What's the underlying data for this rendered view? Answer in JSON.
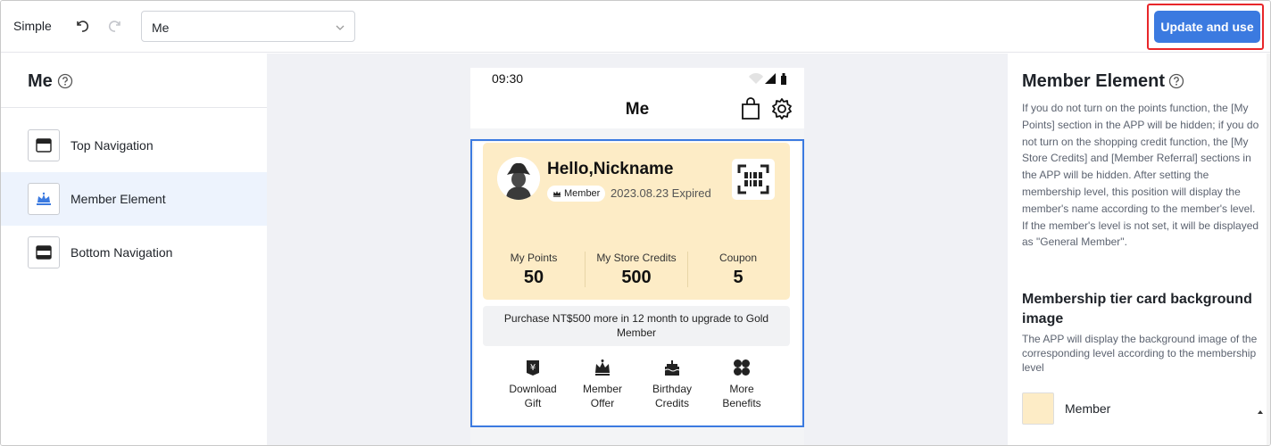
{
  "topbar": {
    "mode_label": "Simple",
    "page_select_value": "Me",
    "update_button_label": "Update and use"
  },
  "left_panel": {
    "title": "Me",
    "items": [
      {
        "label": "Top Navigation",
        "icon": "top-navigation-icon",
        "active": false
      },
      {
        "label": "Member Element",
        "icon": "crown-icon",
        "active": true
      },
      {
        "label": "Bottom Navigation",
        "icon": "bottom-navigation-icon",
        "active": false
      }
    ]
  },
  "phone": {
    "time": "09:30",
    "title": "Me",
    "member": {
      "greeting": "Hello,Nickname",
      "badge": "Member",
      "expires": "2023.08.23 Expired",
      "stats": [
        {
          "label": "My Points",
          "value": "50"
        },
        {
          "label": "My Store Credits",
          "value": "500"
        },
        {
          "label": "Coupon",
          "value": "5"
        }
      ],
      "upgrade_text": "Purchase NT$500 more in 12 month to upgrade to Gold Member",
      "benefits": [
        {
          "line1": "Download",
          "line2": "Gift",
          "icon": "gift-icon"
        },
        {
          "line1": "Member",
          "line2": "Offer",
          "icon": "crown-icon"
        },
        {
          "line1": "Birthday",
          "line2": "Credits",
          "icon": "cake-icon"
        },
        {
          "line1": "More",
          "line2": "Benefits",
          "icon": "grid-icon"
        }
      ]
    }
  },
  "right_panel": {
    "title": "Member Element",
    "description": "If you do not turn on the points function, the [My Points] section in the APP will be hidden; if you do not turn on the shopping credit function, the [My Store Credits] and [Member Referral] sections in the APP will be hidden. After setting the membership level, this position will display the member's name according to the member's level. If the member's level is not set, it will be displayed as \"General Member\".",
    "bg_section_title": "Membership tier card background image",
    "bg_section_desc": "The APP will display the background image of the corresponding level according to the membership level",
    "tier_label": "Member"
  },
  "colors": {
    "accent": "#3b7ae0",
    "card_bg": "#fdecc6",
    "highlight": "#e8262a"
  }
}
